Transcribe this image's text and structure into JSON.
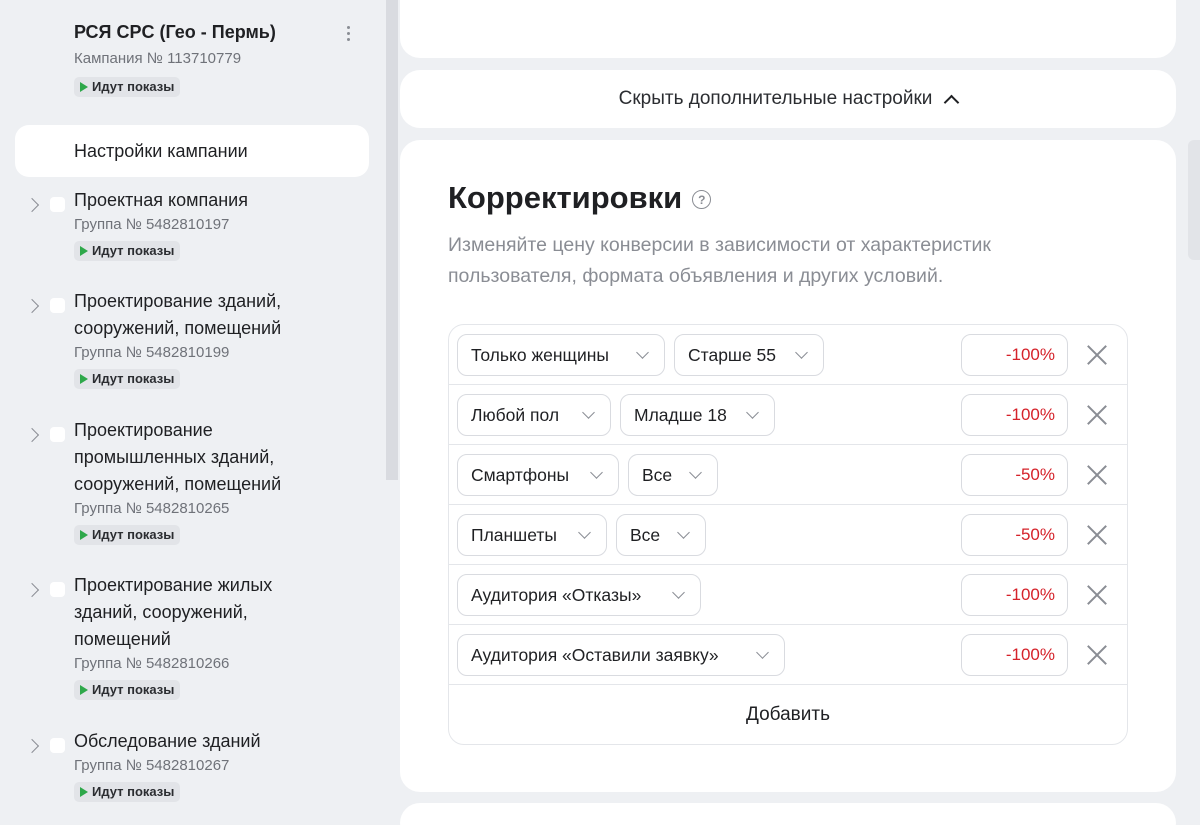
{
  "sidebar": {
    "campaign": {
      "title": "РСЯ CPC (Гео - Пермь)",
      "number": "Кампания № 113710779",
      "status": "Идут показы"
    },
    "settings_label": "Настройки кампании",
    "groups": [
      {
        "name": "Проектная компания",
        "number": "Группа № 5482810197",
        "status": "Идут показы"
      },
      {
        "name": "Проектирование зданий, сооружений, помещений",
        "number": "Группа № 5482810199",
        "status": "Идут показы"
      },
      {
        "name": "Проектирование промышленных зданий, сооружений, помещений",
        "number": "Группа № 5482810265",
        "status": "Идут показы"
      },
      {
        "name": "Проектирование жилых зданий, сооружений, помещений",
        "number": "Группа № 5482810266",
        "status": "Идут показы"
      },
      {
        "name": "Обследование зданий",
        "number": "Группа № 5482810267",
        "status": "Идут показы"
      }
    ]
  },
  "main": {
    "toggle_label": "Скрыть дополнительные настройки",
    "adjustments": {
      "title": "Корректировки",
      "description": "Изменяйте цену конверсии в зависимости от характеристик пользователя, формата объявления и других условий.",
      "rows": [
        {
          "select1": "Только женщины",
          "select2": "Старше 55",
          "value": "-100%"
        },
        {
          "select1": "Любой пол",
          "select2": "Младше 18",
          "value": "-100%"
        },
        {
          "select1": "Смартфоны",
          "select2": "Все",
          "value": "-50%"
        },
        {
          "select1": "Планшеты",
          "select2": "Все",
          "value": "-50%"
        },
        {
          "select1": "Аудитория «Отказы»",
          "value": "-100%"
        },
        {
          "select1": "Аудитория «Оставили заявку»",
          "value": "-100%"
        }
      ],
      "add_label": "Добавить"
    }
  },
  "colors": {
    "background": "#eef0f3",
    "card": "#ffffff",
    "negative_value": "#d5222a",
    "status_green": "#2ea84a"
  }
}
